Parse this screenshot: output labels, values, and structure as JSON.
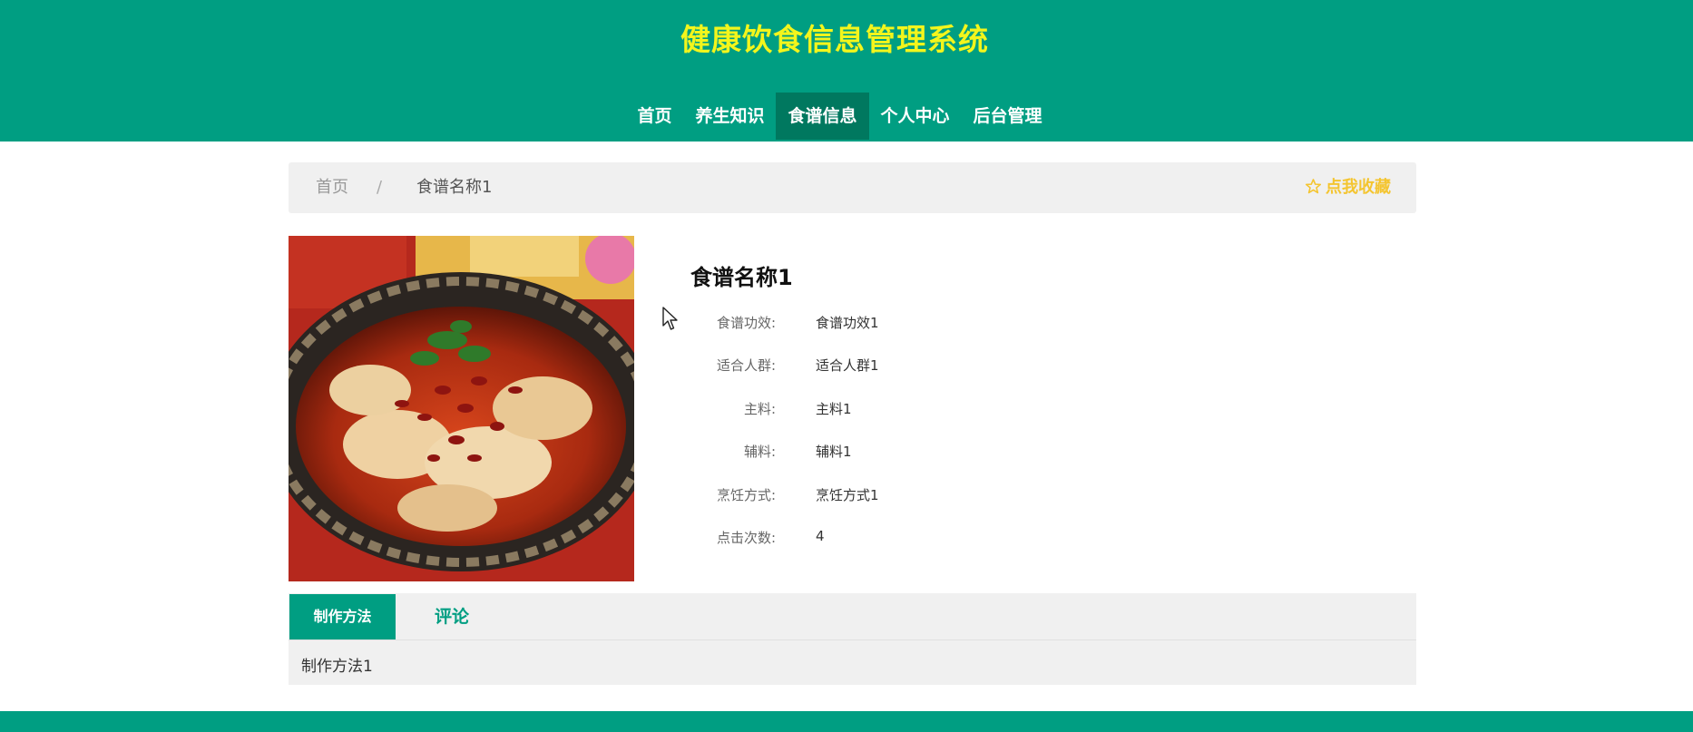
{
  "site": {
    "title": "健康饮食信息管理系统"
  },
  "nav": {
    "items": [
      {
        "label": "首页",
        "active": false
      },
      {
        "label": "养生知识",
        "active": false
      },
      {
        "label": "食谱信息",
        "active": true
      },
      {
        "label": "个人中心",
        "active": false
      },
      {
        "label": "后台管理",
        "active": false
      }
    ]
  },
  "breadcrumb": {
    "home": "首页",
    "separator": "/",
    "current": "食谱名称1"
  },
  "favorite": {
    "label": "点我收藏",
    "icon": "star-outline-icon",
    "color": "#f4c530"
  },
  "recipe": {
    "name": "食谱名称1",
    "image": "spicy-fish-dish-photo",
    "fields": [
      {
        "label": "食谱功效:",
        "value": "食谱功效1"
      },
      {
        "label": "适合人群:",
        "value": "适合人群1"
      },
      {
        "label": "主料:",
        "value": "主料1"
      },
      {
        "label": "辅料:",
        "value": "辅料1"
      },
      {
        "label": "烹饪方式:",
        "value": "烹饪方式1"
      },
      {
        "label": "点击次数:",
        "value": "4"
      }
    ]
  },
  "tabs": {
    "items": [
      {
        "label": "制作方法",
        "active": true
      },
      {
        "label": "评论",
        "active": false
      }
    ],
    "content": "制作方法1"
  },
  "colors": {
    "primary": "#009e82",
    "title": "#f3f51c",
    "nav_active": "#00785f",
    "panel": "#f0f0f0"
  }
}
